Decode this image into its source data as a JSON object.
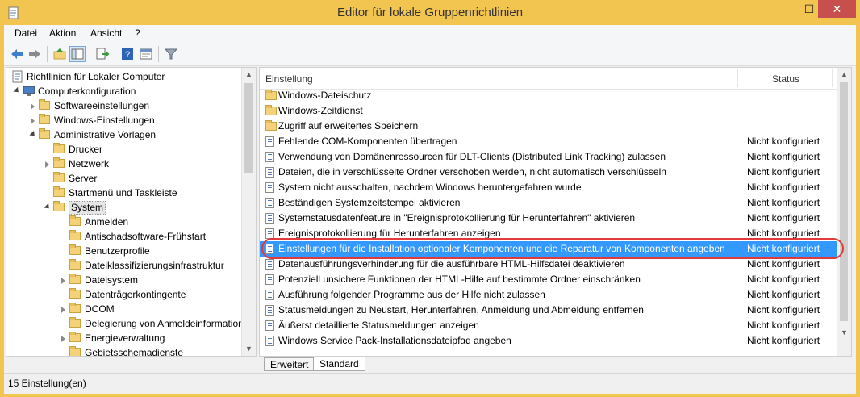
{
  "window": {
    "title": "Editor für lokale Gruppenrichtlinien",
    "minimize": "—",
    "maximize": "☐",
    "close": "✕"
  },
  "menu": [
    "Datei",
    "Aktion",
    "Ansicht",
    "?"
  ],
  "tree": [
    {
      "label": "Richtlinien für Lokaler Computer",
      "level": 0,
      "expander": "none",
      "icon": "policy-icon"
    },
    {
      "label": "Computerkonfiguration",
      "level": 1,
      "expander": "open",
      "icon": "computer-icon"
    },
    {
      "label": "Softwareeinstellungen",
      "level": 2,
      "expander": "closed",
      "icon": "folder-icon"
    },
    {
      "label": "Windows-Einstellungen",
      "level": 2,
      "expander": "closed",
      "icon": "folder-icon"
    },
    {
      "label": "Administrative Vorlagen",
      "level": 2,
      "expander": "open",
      "icon": "folder-icon"
    },
    {
      "label": "Drucker",
      "level": 3,
      "expander": "none",
      "icon": "folder-icon"
    },
    {
      "label": "Netzwerk",
      "level": 3,
      "expander": "closed",
      "icon": "folder-icon"
    },
    {
      "label": "Server",
      "level": 3,
      "expander": "none",
      "icon": "folder-icon"
    },
    {
      "label": "Startmenü und Taskleiste",
      "level": 3,
      "expander": "none",
      "icon": "folder-icon"
    },
    {
      "label": "System",
      "level": 3,
      "expander": "open",
      "icon": "folder-icon",
      "selected": true
    },
    {
      "label": "Anmelden",
      "level": 4,
      "expander": "none",
      "icon": "folder-icon"
    },
    {
      "label": "Antischadsoftware-Frühstart",
      "level": 4,
      "expander": "none",
      "icon": "folder-icon"
    },
    {
      "label": "Benutzerprofile",
      "level": 4,
      "expander": "none",
      "icon": "folder-icon"
    },
    {
      "label": "Dateiklassifizierungsinfrastruktur",
      "level": 4,
      "expander": "none",
      "icon": "folder-icon"
    },
    {
      "label": "Dateisystem",
      "level": 4,
      "expander": "closed",
      "icon": "folder-icon"
    },
    {
      "label": "Datenträgerkontingente",
      "level": 4,
      "expander": "none",
      "icon": "folder-icon"
    },
    {
      "label": "DCOM",
      "level": 4,
      "expander": "closed",
      "icon": "folder-icon"
    },
    {
      "label": "Delegierung von Anmeldeinformationen",
      "level": 4,
      "expander": "none",
      "icon": "folder-icon"
    },
    {
      "label": "Energieverwaltung",
      "level": 4,
      "expander": "closed",
      "icon": "folder-icon"
    },
    {
      "label": "Gebietsschemadienste",
      "level": 4,
      "expander": "none",
      "icon": "folder-icon"
    }
  ],
  "list": {
    "columns": {
      "setting": "Einstellung",
      "status": "Status"
    },
    "rows": [
      {
        "name": "Windows-Dateischutz",
        "status": "",
        "type": "folder"
      },
      {
        "name": "Windows-Zeitdienst",
        "status": "",
        "type": "folder"
      },
      {
        "name": "Zugriff auf erweitertes Speichern",
        "status": "",
        "type": "folder"
      },
      {
        "name": "Fehlende COM-Komponenten übertragen",
        "status": "Nicht konfiguriert",
        "type": "setting"
      },
      {
        "name": "Verwendung von Domänenressourcen für DLT-Clients (Distributed Link Tracking) zulassen",
        "status": "Nicht konfiguriert",
        "type": "setting"
      },
      {
        "name": "Dateien, die in verschlüsselte Ordner verschoben werden, nicht automatisch verschlüsseln",
        "status": "Nicht konfiguriert",
        "type": "setting"
      },
      {
        "name": "System nicht ausschalten, nachdem Windows heruntergefahren wurde",
        "status": "Nicht konfiguriert",
        "type": "setting"
      },
      {
        "name": "Beständigen Systemzeitstempel aktivieren",
        "status": "Nicht konfiguriert",
        "type": "setting"
      },
      {
        "name": "Systemstatusdatenfeature in \"Ereignisprotokollierung für Herunterfahren\" aktivieren",
        "status": "Nicht konfiguriert",
        "type": "setting"
      },
      {
        "name": "Ereignisprotokollierung für Herunterfahren anzeigen",
        "status": "Nicht konfiguriert",
        "type": "setting"
      },
      {
        "name": "Einstellungen für die Installation optionaler Komponenten und die Reparatur von Komponenten angeben",
        "status": "Nicht konfiguriert",
        "type": "setting",
        "selected": true
      },
      {
        "name": "Datenausführungsverhinderung für die ausführbare HTML-Hilfsdatei deaktivieren",
        "status": "Nicht konfiguriert",
        "type": "setting"
      },
      {
        "name": "Potenziell unsichere Funktionen der HTML-Hilfe auf bestimmte Ordner einschränken",
        "status": "Nicht konfiguriert",
        "type": "setting"
      },
      {
        "name": "Ausführung folgender Programme aus der Hilfe nicht zulassen",
        "status": "Nicht konfiguriert",
        "type": "setting"
      },
      {
        "name": "Statusmeldungen zu Neustart, Herunterfahren, Anmeldung und Abmeldung entfernen",
        "status": "Nicht konfiguriert",
        "type": "setting"
      },
      {
        "name": "Äußerst detaillierte Statusmeldungen anzeigen",
        "status": "Nicht konfiguriert",
        "type": "setting"
      },
      {
        "name": "Windows Service Pack-Installationsdateipfad angeben",
        "status": "Nicht konfiguriert",
        "type": "setting"
      }
    ]
  },
  "tabs": [
    "Erweitert",
    "Standard"
  ],
  "statusbar": {
    "text": "15 Einstellung(en)"
  },
  "colors": {
    "titlebar": "#f1c550",
    "selection": "#3399ff",
    "annotation": "#e23a3a"
  }
}
